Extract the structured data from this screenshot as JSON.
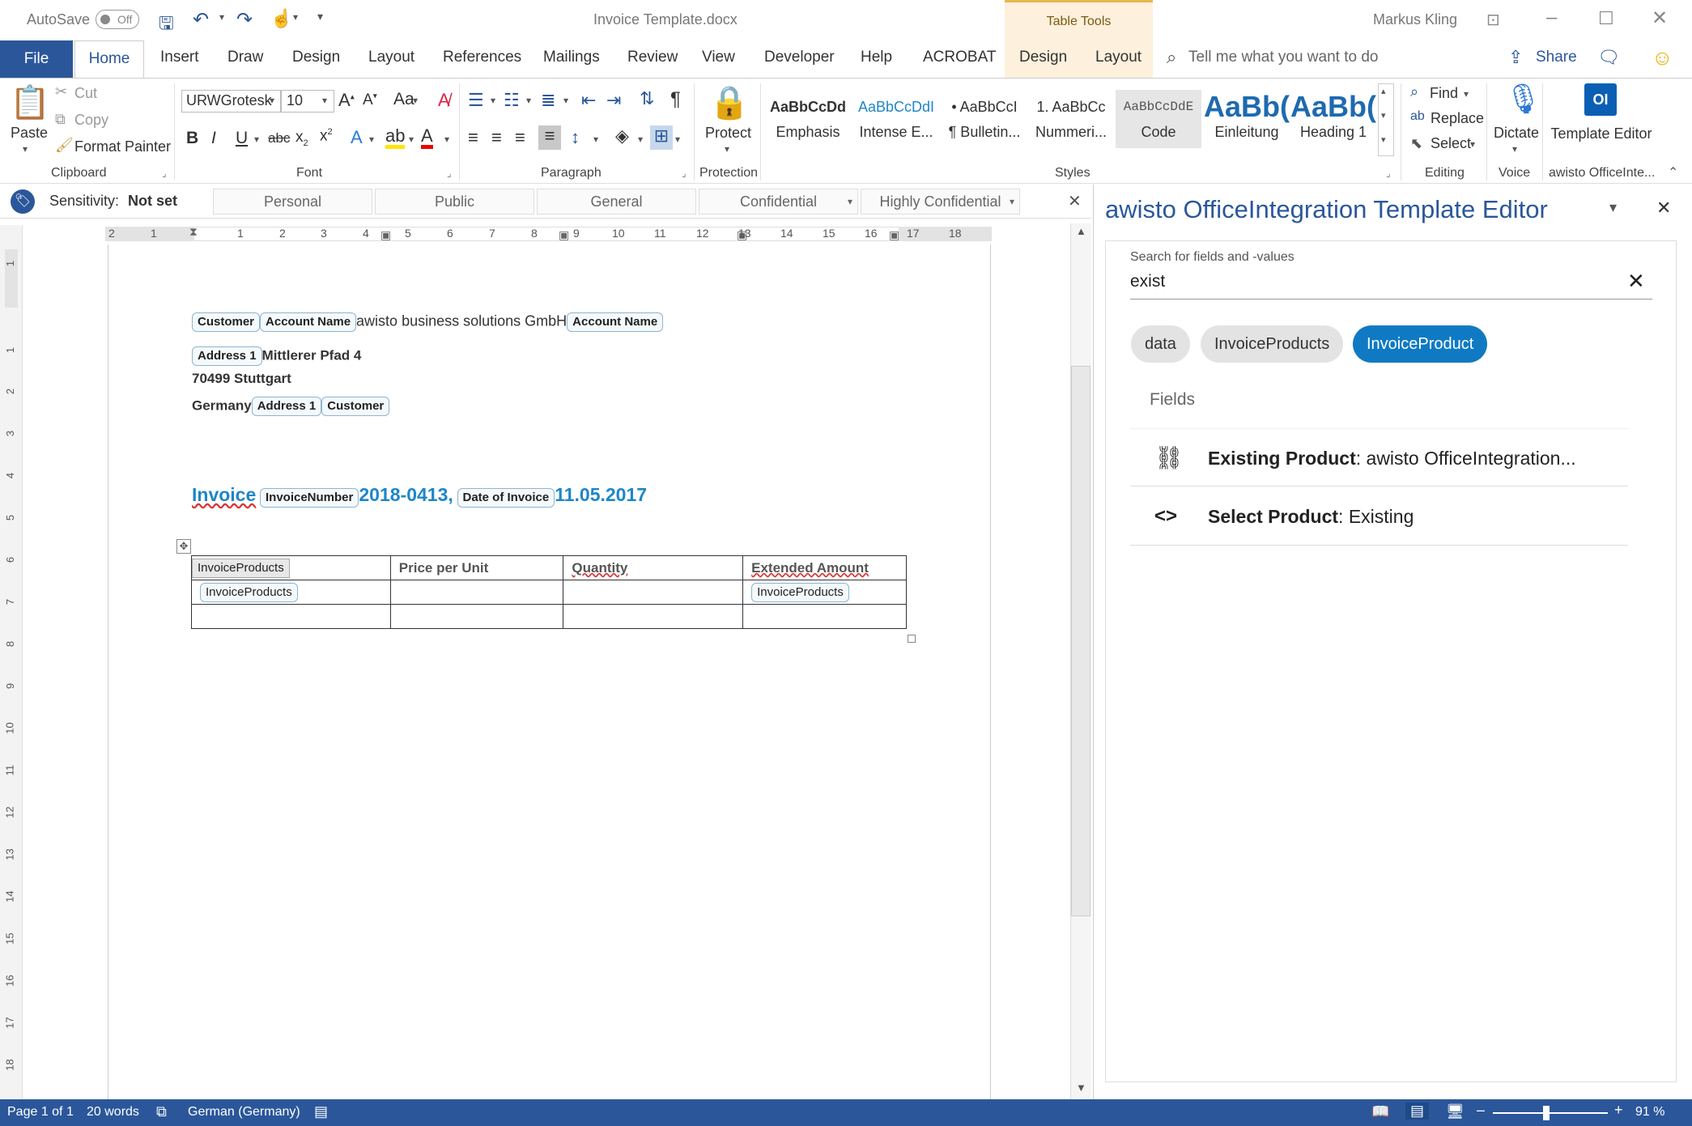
{
  "titlebar": {
    "autosave_label": "AutoSave",
    "autosave_state": "Off",
    "doc_title": "Invoice Template.docx",
    "context_group": "Table Tools",
    "user": "Markus Kling"
  },
  "tabs": [
    "File",
    "Home",
    "Insert",
    "Draw",
    "Design",
    "Layout",
    "References",
    "Mailings",
    "Review",
    "View",
    "Developer",
    "Help",
    "ACROBAT",
    "Design",
    "Layout"
  ],
  "tell_me": "Tell me what you want to do",
  "share": "Share",
  "clipboard": {
    "paste": "Paste",
    "cut": "Cut",
    "copy": "Copy",
    "format_painter": "Format Painter",
    "label": "Clipboard"
  },
  "font": {
    "name": "URWGrotesk",
    "size": "10",
    "case": "Aa",
    "label": "Font"
  },
  "paragraph": {
    "label": "Paragraph"
  },
  "protection": {
    "protect": "Protect",
    "label": "Protection"
  },
  "styles": {
    "label": "Styles",
    "items": [
      {
        "preview": "AaBbCcDd",
        "name": "Emphasis"
      },
      {
        "preview": "AaBbCcDdI",
        "name": "Intense E..."
      },
      {
        "preview": "• AaBbCcI",
        "name": "¶ Bulletin..."
      },
      {
        "preview": "1. AaBbCc",
        "name": "Nummeri..."
      },
      {
        "preview": "AaBbCcDdE",
        "name": "Code"
      },
      {
        "preview": "AaBb(",
        "name": "Einleitung"
      },
      {
        "preview": "AaBb(",
        "name": "Heading 1"
      }
    ]
  },
  "editing": {
    "find": "Find",
    "replace": "Replace",
    "select": "Select",
    "label": "Editing"
  },
  "voice": {
    "dictate": "Dictate",
    "label": "Voice"
  },
  "addin": {
    "name": "Template Editor",
    "label": "awisto OfficeInte..."
  },
  "sensitivity": {
    "label": "Sensitivity:",
    "value": "Not set",
    "options": [
      "Personal",
      "Public",
      "General",
      "Confidential",
      "Highly Confidential"
    ]
  },
  "hruler_nums": [
    "2",
    "1",
    "1",
    "2",
    "3",
    "4",
    "5",
    "6",
    "7",
    "8",
    "9",
    "10",
    "11",
    "12",
    "13",
    "14",
    "15",
    "16",
    "17",
    "18"
  ],
  "vruler_nums": [
    "1",
    "1",
    "2",
    "3",
    "4",
    "5",
    "6",
    "7",
    "8",
    "9",
    "10",
    "11",
    "12",
    "13",
    "14",
    "15",
    "16",
    "17",
    "18"
  ],
  "document": {
    "line1": {
      "cc1": "Customer",
      "cc2": "Account Name",
      "text": "awisto business solutions GmbH",
      "cc3": "Account Name"
    },
    "line2": {
      "cc1": "Address 1",
      "text": "Mittlerer Pfad 4"
    },
    "line3": {
      "text": "70499 Stuttgart"
    },
    "line4": {
      "text": "Germany",
      "cc1": "Address 1",
      "cc2": "Customer"
    },
    "invoice": {
      "label": "Invoice",
      "cc1": "InvoiceNumber",
      "number": "2018-0413",
      "comma": ",",
      "cc2": "Date of Invoice",
      "date": "11.05.2017"
    },
    "table": {
      "headers": [
        "InvoiceProducts",
        "Price per Unit",
        "Quantity",
        "Extended Amount"
      ],
      "row1": {
        "cc_start": "InvoiceProducts",
        "cc_end": "InvoiceProducts"
      }
    }
  },
  "panel": {
    "title": "awisto OfficeIntegration Template Editor",
    "search_label": "Search for fields and -values",
    "search_value": "exist",
    "chips": [
      "data",
      "InvoiceProducts",
      "InvoiceProduct"
    ],
    "fields_label": "Fields",
    "fields": [
      {
        "name": "Existing Product",
        "value": "awisto OfficeIntegration...",
        "icon": "link-icon"
      },
      {
        "name": "Select Product",
        "value": "Existing",
        "icon": "code-icon"
      }
    ]
  },
  "status": {
    "page": "Page 1 of 1",
    "words": "20 words",
    "language": "German (Germany)",
    "zoom": "91 %"
  },
  "colors": {
    "brand": "#2b579a",
    "accent": "#1e86c8",
    "chip_active": "#0f7ac3"
  }
}
